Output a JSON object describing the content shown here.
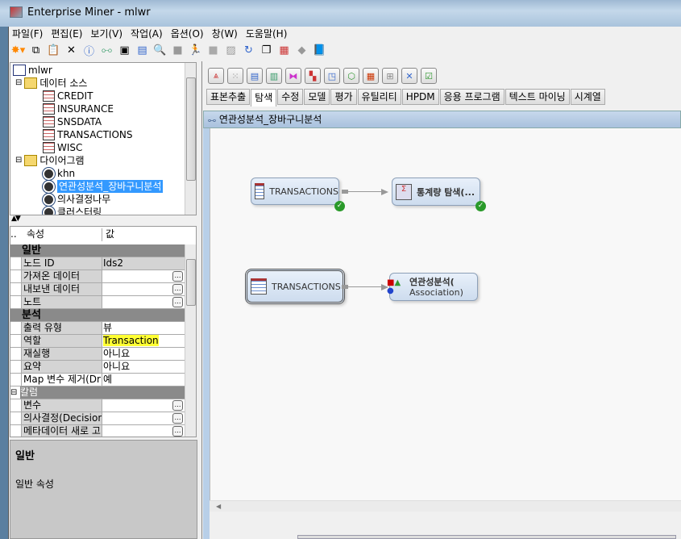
{
  "window": {
    "title": "Enterprise Miner - mlwr"
  },
  "menu": [
    "파일(F)",
    "편집(E)",
    "보기(V)",
    "작업(A)",
    "옵션(O)",
    "창(W)",
    "도움말(H)"
  ],
  "toolbar_icons": [
    "new-icon",
    "copy-icon",
    "paste-icon",
    "delete-icon",
    "properties-icon",
    "diagram-icon",
    "log-icon",
    "notes-icon",
    "explore-icon",
    "folder-icon",
    "run-icon",
    "stop-icon",
    "results-icon",
    "refresh-icon",
    "windows-icon",
    "report-icon",
    "export-icon",
    "help-icon"
  ],
  "tree": {
    "root": "mlwr",
    "data_sources_label": "데이터 소스",
    "data_sources": [
      "CREDIT",
      "INSURANCE",
      "SNSDATA",
      "TRANSACTIONS",
      "WISC"
    ],
    "diagrams_label": "다이어그램",
    "diagrams": [
      "khn",
      "연관성분석_장바구니분석",
      "의사결정나무",
      "클러스터링"
    ],
    "selected": "연관성분석_장바구니분석"
  },
  "properties": {
    "header": {
      "dots": "..",
      "name": "속성",
      "value": "값"
    },
    "groups": {
      "general": "일반",
      "analysis": "분석",
      "columns": "칼럼"
    },
    "rows": [
      {
        "name": "노드 ID",
        "value": "Ids2"
      },
      {
        "name": "가져온 데이터",
        "value": ""
      },
      {
        "name": "내보낸 데이터",
        "value": ""
      },
      {
        "name": "노트",
        "value": ""
      },
      {
        "name": "출력 유형",
        "value": "뷰"
      },
      {
        "name": "역할",
        "value": "Transaction"
      },
      {
        "name": "재실행",
        "value": "아니요"
      },
      {
        "name": "요약",
        "value": "아니요"
      },
      {
        "name": "Map 변수 제거(Dr",
        "value": "예"
      },
      {
        "name": "변수",
        "value": ""
      },
      {
        "name": "의사결정(Decision",
        "value": ""
      },
      {
        "name": "메타데이터 새로 고",
        "value": ""
      }
    ]
  },
  "description": {
    "title": "일반",
    "text": "일반 속성"
  },
  "node_tools": [
    "multiplot-icon",
    "stat-explore-icon",
    "graph-explore-icon",
    "segment-profile-icon",
    "association-icon",
    "variable-clustering-icon",
    "path-analysis-icon",
    "link-analysis-icon",
    "cluster-icon",
    "market-basket-icon",
    "dmdb-icon",
    "variable-selection-icon"
  ],
  "tabs": [
    "표본추출",
    "탐색",
    "수정",
    "모델",
    "평가",
    "유틸리티",
    "HPDM",
    "응용 프로그램",
    "텍스트 마이닝",
    "시계열"
  ],
  "active_tab": "탐색",
  "diagram": {
    "title": "연관성분석_장바구니분석",
    "nodes": [
      {
        "label": "TRANSACTIONS",
        "status": "complete"
      },
      {
        "label": "통계량 탐색(...",
        "status": "complete"
      },
      {
        "label": "TRANSACTIONS",
        "status": "selected"
      },
      {
        "label1": "연관성분석(",
        "label2": "Association)"
      }
    ]
  }
}
